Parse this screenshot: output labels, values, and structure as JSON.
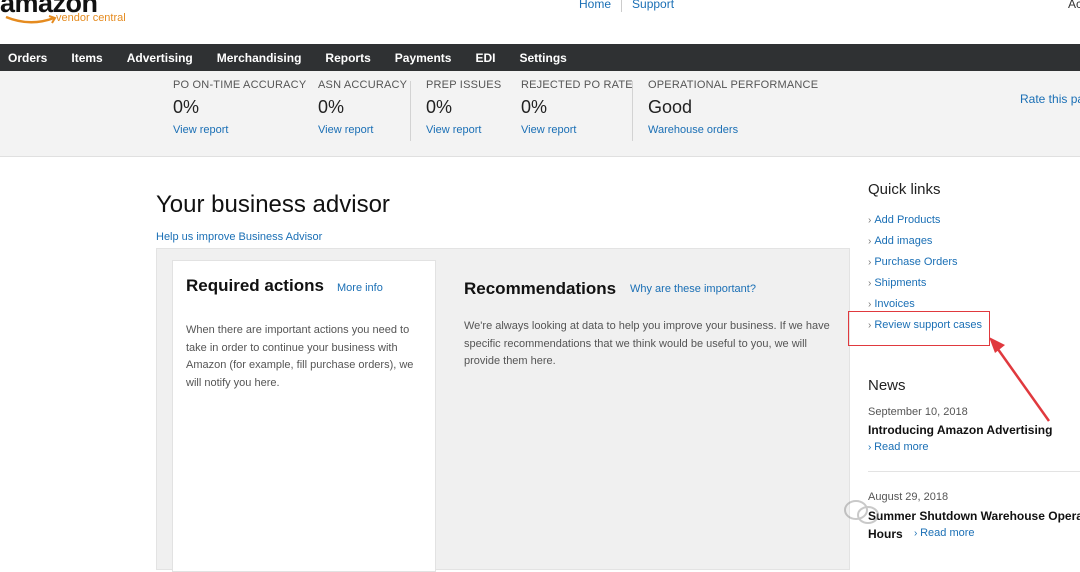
{
  "header": {
    "logo_text": "amazon",
    "logo_sub": "vendor central",
    "links": [
      "Home",
      "Support"
    ],
    "right_text": "Ac"
  },
  "nav": {
    "items": [
      "Orders",
      "Items",
      "Advertising",
      "Merchandising",
      "Reports",
      "Payments",
      "EDI",
      "Settings"
    ]
  },
  "metrics": [
    {
      "label": "PO ON-TIME ACCURACY",
      "value": "0%",
      "link": "View report"
    },
    {
      "label": "ASN ACCURACY",
      "value": "0%",
      "link": "View report"
    },
    {
      "label": "PREP ISSUES",
      "value": "0%",
      "link": "View report"
    },
    {
      "label": "REJECTED PO RATE",
      "value": "0%",
      "link": "View report"
    },
    {
      "label": "OPERATIONAL PERFORMANCE",
      "value": "Good",
      "link": "Warehouse orders"
    }
  ],
  "rate_link": "Rate this pag",
  "advisor": {
    "title": "Your business advisor",
    "help_link": "Help us improve Business Advisor",
    "required": {
      "title": "Required actions",
      "more": "More info",
      "text": "When there are important actions you need to take in order to continue your business with Amazon (for example, fill purchase orders), we will notify you here."
    },
    "recommendations": {
      "title": "Recommendations",
      "why": "Why are these important?",
      "text": "We're always looking at data to help you improve your business. If we have specific recommendations that we think would be useful to you, we will provide them here."
    }
  },
  "quick_links": {
    "title": "Quick links",
    "items": [
      "Add Products",
      "Add images",
      "Purchase Orders",
      "Shipments",
      "Invoices",
      "Review support cases"
    ]
  },
  "news": {
    "title": "News",
    "items": [
      {
        "date": "September 10, 2018",
        "headline": "Introducing Amazon Advertising",
        "more": "Read more"
      },
      {
        "date": "August 29, 2018",
        "headline": "Summer Shutdown Warehouse Operating",
        "headline_cont": "Hours",
        "more": "Read more"
      }
    ]
  },
  "colors": {
    "nav_bg": "#2f3133",
    "link": "#1a6fb5",
    "highlight": "#e0393e",
    "logo_accent": "#e58b1f"
  }
}
